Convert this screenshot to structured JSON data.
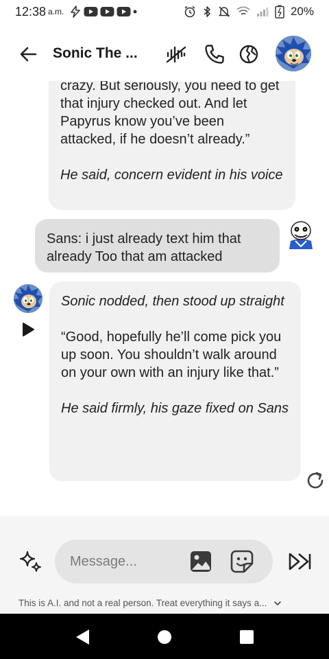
{
  "status_bar": {
    "time": "12:38",
    "ampm": "a.m.",
    "battery": "20%",
    "icons": [
      "bolt-icon",
      "youtube-icon",
      "youtube-icon",
      "youtube-icon",
      "dot-icon",
      "alarm-icon",
      "bluetooth-icon",
      "mute-icon",
      "wifi-icon",
      "signal-icon",
      "battery-icon"
    ]
  },
  "header": {
    "title": "Sonic The ...",
    "icons": [
      "back-arrow-icon",
      "voice-wave-icon",
      "phone-icon",
      "globe-icon"
    ]
  },
  "messages": [
    {
      "id": "bot-1",
      "sender": "bot",
      "lines": [
        {
          "text": "crazy. But seriously, you need to get that injury checked out. And let Papyrus know you’ve been attacked, if he doesn’t already.”",
          "italic": false
        },
        {
          "text": "He said, concern evident in his voice",
          "italic": true
        }
      ]
    },
    {
      "id": "user-1",
      "sender": "user",
      "text": "Sans: i just already text him that already Too that am attacked"
    },
    {
      "id": "bot-2",
      "sender": "bot",
      "lines": [
        {
          "text": "Sonic nodded, then stood up straight",
          "italic": true
        },
        {
          "text": "“Good, hopefully he’ll come pick you up soon. You shouldn’t walk around on your own with an injury like that.”",
          "italic": false
        },
        {
          "text": "He said firmly, his gaze fixed on Sans",
          "italic": true
        }
      ]
    }
  ],
  "composer": {
    "placeholder": "Message...",
    "icons": [
      "sparkle-icon",
      "gallery-icon",
      "sticker-icon",
      "send-icon"
    ]
  },
  "disclaimer": "This is A.I. and not a real person. Treat everything it says a...",
  "colors": {
    "bot_bubble": "#f1f1f1",
    "user_bubble": "#dfdfdf",
    "composer_bg": "#f5f5f5",
    "pill_bg": "#e4e4e4",
    "sonic_blue": "#2b5db5"
  }
}
